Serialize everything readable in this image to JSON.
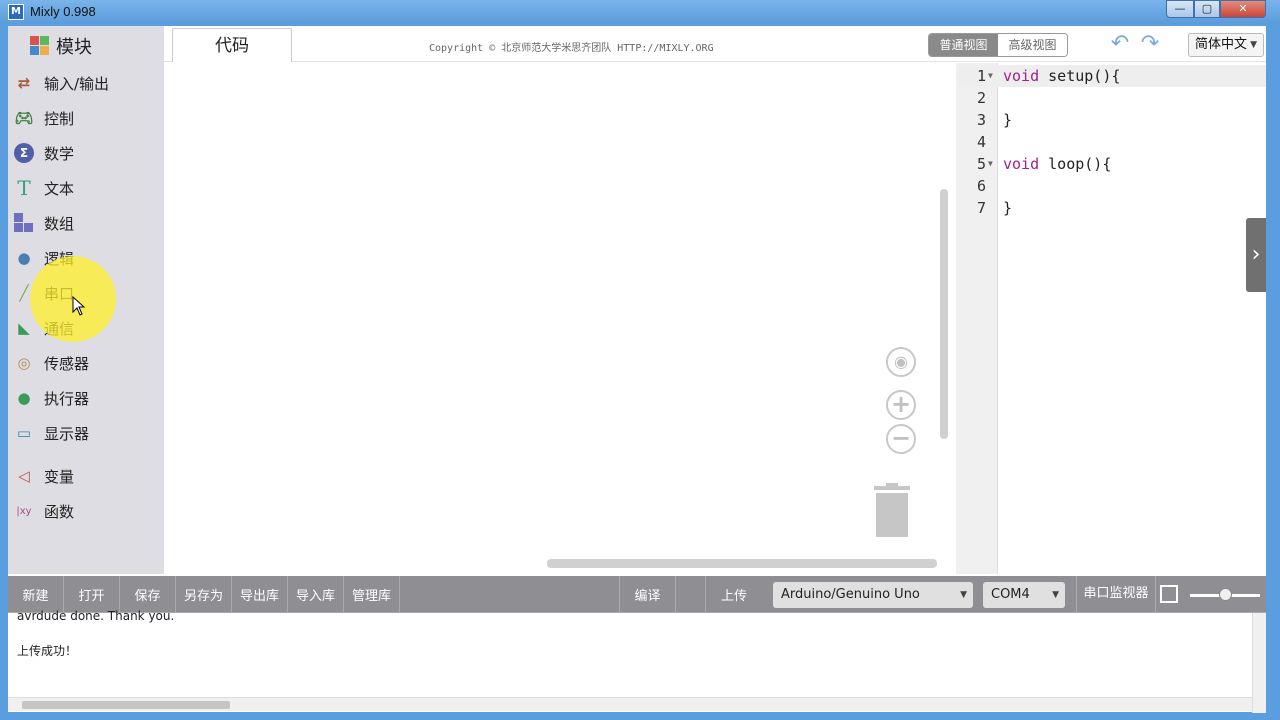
{
  "window": {
    "title": "Mixly 0.998",
    "app_icon": "M"
  },
  "sidebar": {
    "header": "模块",
    "items": [
      {
        "label": "输入/输出",
        "icon": "io-arrows-icon",
        "color": "#a85a3c"
      },
      {
        "label": "控制",
        "icon": "gamepad-icon",
        "color": "#3a7a3a"
      },
      {
        "label": "数学",
        "icon": "sigma-icon",
        "color": "#4f5fa8"
      },
      {
        "label": "文本",
        "icon": "text-t-icon",
        "color": "#3aa07a"
      },
      {
        "label": "数组",
        "icon": "blocks-icon",
        "color": "#6f6fbf"
      },
      {
        "label": "逻辑",
        "icon": "lightbulb-icon",
        "color": "#4a7fb0"
      },
      {
        "label": "串口",
        "icon": "usb-plug-icon",
        "color": "#7ab04a"
      },
      {
        "label": "通信",
        "icon": "satellite-dish-icon",
        "color": "#3a9a5a"
      },
      {
        "label": "传感器",
        "icon": "sensor-icon",
        "color": "#b0904a"
      },
      {
        "label": "执行器",
        "icon": "actuator-icon",
        "color": "#3a9a5a"
      },
      {
        "label": "显示器",
        "icon": "monitor-icon",
        "color": "#3a8ab0"
      },
      {
        "label": "变量",
        "icon": "variable-icon",
        "color": "#c05050"
      },
      {
        "label": "函数",
        "icon": "function-xy-icon",
        "color": "#a05080"
      }
    ]
  },
  "header": {
    "tab_code": "代码",
    "copyright": "Copyright © 北京师范大学米思齐团队 HTTP://MIXLY.ORG",
    "view_normal": "普通视图",
    "view_advanced": "高级视图",
    "language": "简体中文"
  },
  "editor": {
    "lines": [
      {
        "num": "1",
        "fold": true,
        "text": "void setup(){"
      },
      {
        "num": "2",
        "fold": false,
        "text": ""
      },
      {
        "num": "3",
        "fold": false,
        "text": "}"
      },
      {
        "num": "4",
        "fold": false,
        "text": ""
      },
      {
        "num": "5",
        "fold": true,
        "text": "void loop(){"
      },
      {
        "num": "6",
        "fold": false,
        "text": ""
      },
      {
        "num": "7",
        "fold": false,
        "text": "}"
      }
    ]
  },
  "toolbar": {
    "new": "新建",
    "open": "打开",
    "save": "保存",
    "save_as": "另存为",
    "export_lib": "导出库",
    "import_lib": "导入库",
    "manage_lib": "管理库",
    "compile": "编译",
    "upload": "上传",
    "board": "Arduino/Genuino Uno",
    "port": "COM4",
    "serial_monitor": "串口监视器"
  },
  "console": {
    "line1": "avrdude done.  Thank you.",
    "line2": "上传成功！"
  },
  "colors": {
    "title_bar": "#5a9cdc",
    "sidebar_bg": "#dddde3",
    "toolbar_bg": "#8f8f93",
    "keyword": "#a0208c",
    "cursor_halo": "#fff028"
  }
}
